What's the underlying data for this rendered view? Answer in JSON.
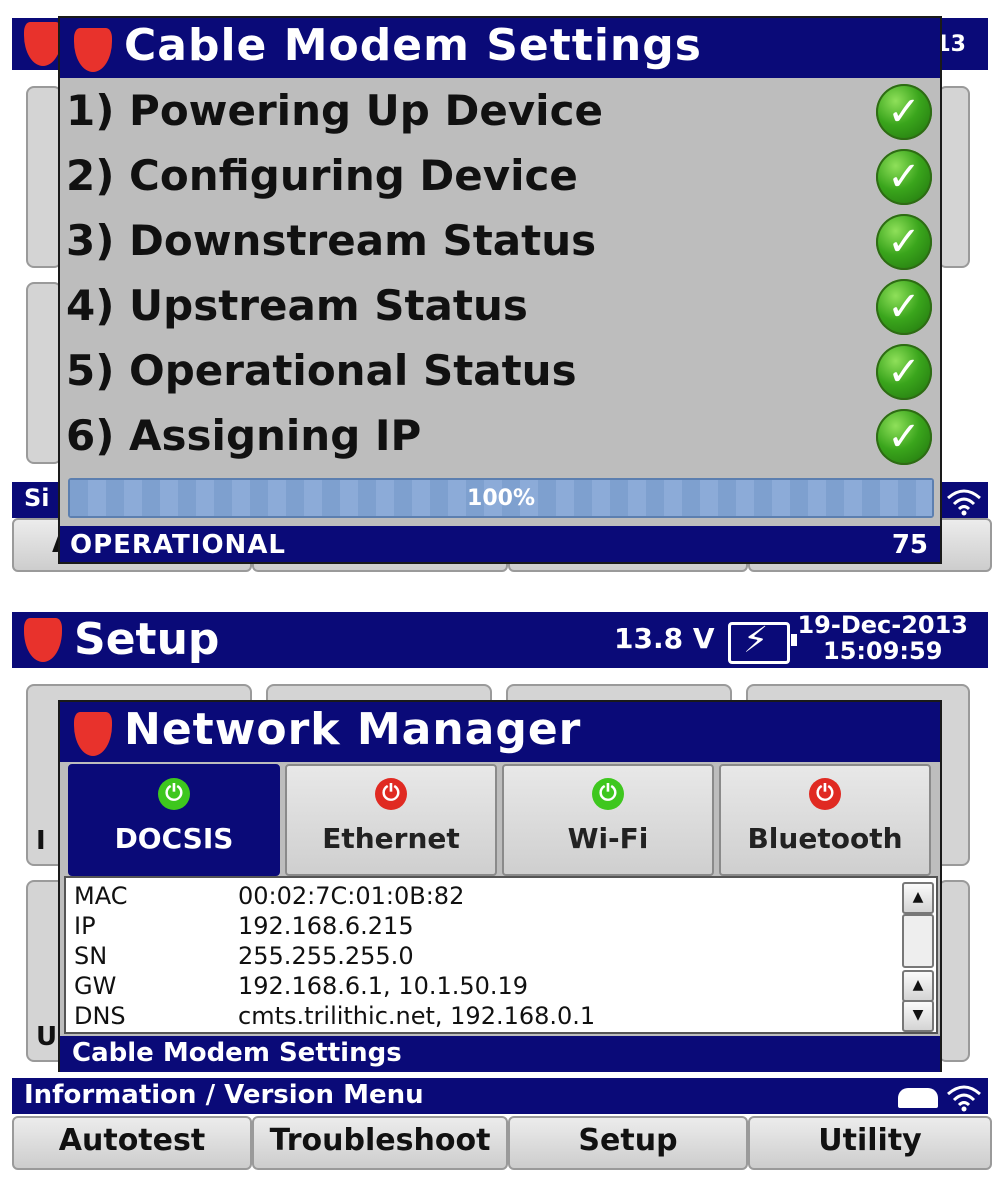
{
  "screen1": {
    "header_clock_fragment": "13",
    "dialog_title": "Cable Modem Settings",
    "steps": [
      {
        "label": "1) Powering Up Device",
        "status": "complete"
      },
      {
        "label": "2) Configuring Device",
        "status": "complete"
      },
      {
        "label": "3) Downstream Status",
        "status": "complete"
      },
      {
        "label": "4) Upstream Status",
        "status": "complete"
      },
      {
        "label": "5) Operational Status",
        "status": "complete"
      },
      {
        "label": "6) Assigning IP",
        "status": "complete"
      }
    ],
    "check_glyph": "✓",
    "progress": {
      "value": 1.0,
      "label": "100%"
    },
    "status_left": "OPERATIONAL",
    "status_right": "75",
    "menu_strip_fragment": "Si",
    "bottom_fragment": "A"
  },
  "screen2": {
    "header": {
      "title": "Setup",
      "voltage": "13.8 V",
      "date": "19-Dec-2013",
      "time": "15:09:59",
      "battery_icon": "battery-charging-icon"
    },
    "bg_fragments": {
      "left1": "I",
      "left2": "U"
    },
    "dialog_title": "Network Manager",
    "tabs": [
      {
        "label": "DOCSIS",
        "power": "on",
        "active": true
      },
      {
        "label": "Ethernet",
        "power": "off",
        "active": false
      },
      {
        "label": "Wi-Fi",
        "power": "on",
        "active": false
      },
      {
        "label": "Bluetooth",
        "power": "off",
        "active": false
      }
    ],
    "power_glyph": "⏻",
    "info": [
      {
        "key": "MAC",
        "value": "00:02:7C:01:0B:82"
      },
      {
        "key": "IP",
        "value": "192.168.6.215"
      },
      {
        "key": "SN",
        "value": "255.255.255.0"
      },
      {
        "key": "GW",
        "value": "192.168.6.1, 10.1.50.19"
      },
      {
        "key": "DNS",
        "value": "cmts.trilithic.net, 192.168.0.1"
      }
    ],
    "scroll_up_glyph": "▲",
    "scroll_down_glyph": "▼",
    "dialog_status": "Cable Modem Settings",
    "menu_strip": "Information / Version Menu",
    "nav": [
      "Autotest",
      "Troubleshoot",
      "Setup",
      "Utility"
    ]
  },
  "colors": {
    "navy": "#0a0a78",
    "shield_red": "#e8322c",
    "check_green": "#3aa51c",
    "power_on": "#3ec71e",
    "power_off": "#e02a22",
    "progress_blue": "#8cabd8"
  }
}
